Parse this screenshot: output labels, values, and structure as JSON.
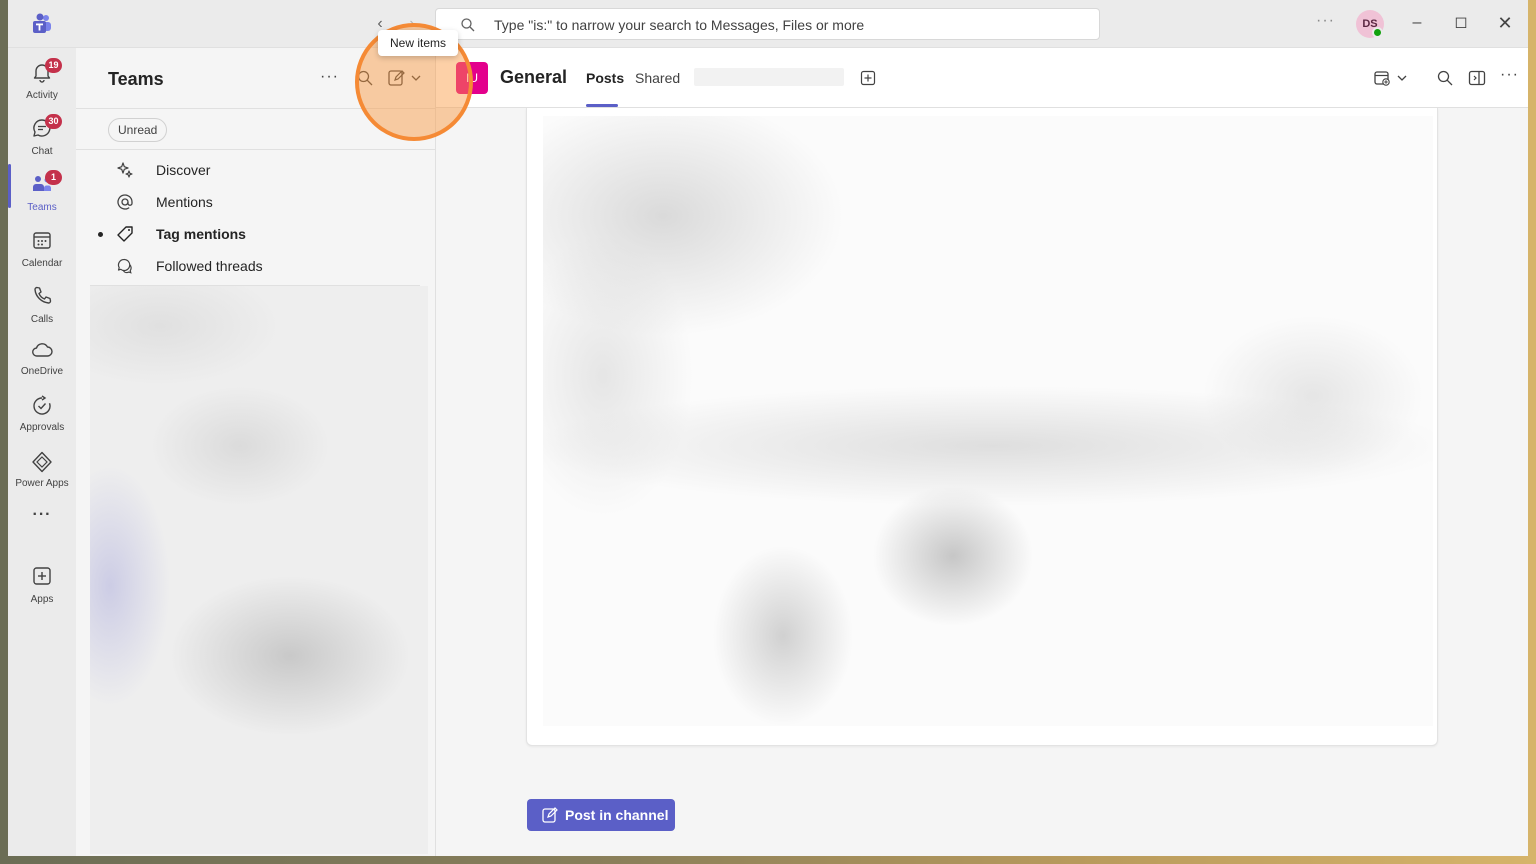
{
  "titlebar": {
    "search_placeholder": "Type \"is:\" to narrow your search to Messages, Files or more",
    "avatar_initials": "DS",
    "more_label": "···"
  },
  "rail": {
    "items": [
      {
        "label": "Activity",
        "badge": "19"
      },
      {
        "label": "Chat",
        "badge": "30"
      },
      {
        "label": "Teams",
        "badge": "1"
      },
      {
        "label": "Calendar"
      },
      {
        "label": "Calls"
      },
      {
        "label": "OneDrive"
      },
      {
        "label": "Approvals"
      },
      {
        "label": "Power Apps"
      },
      {
        "label": "···"
      },
      {
        "label": "Apps"
      }
    ]
  },
  "teams_pane": {
    "title": "Teams",
    "more_label": "···",
    "filter_label": "Unread",
    "nav": [
      {
        "label": "Discover"
      },
      {
        "label": "Mentions"
      },
      {
        "label": "Tag mentions"
      },
      {
        "label": "Followed threads"
      }
    ]
  },
  "tooltip": {
    "label": "New items"
  },
  "channel": {
    "team_initials": "IU",
    "name": "General",
    "tabs": [
      {
        "label": "Posts"
      },
      {
        "label": "Shared"
      }
    ],
    "more_label": "···",
    "post_button_label": "Post in channel"
  },
  "colors": {
    "accent": "#5b5fc7",
    "badge": "#c4314b",
    "team_tile": "#e3008c",
    "highlight": "#f58a35"
  }
}
